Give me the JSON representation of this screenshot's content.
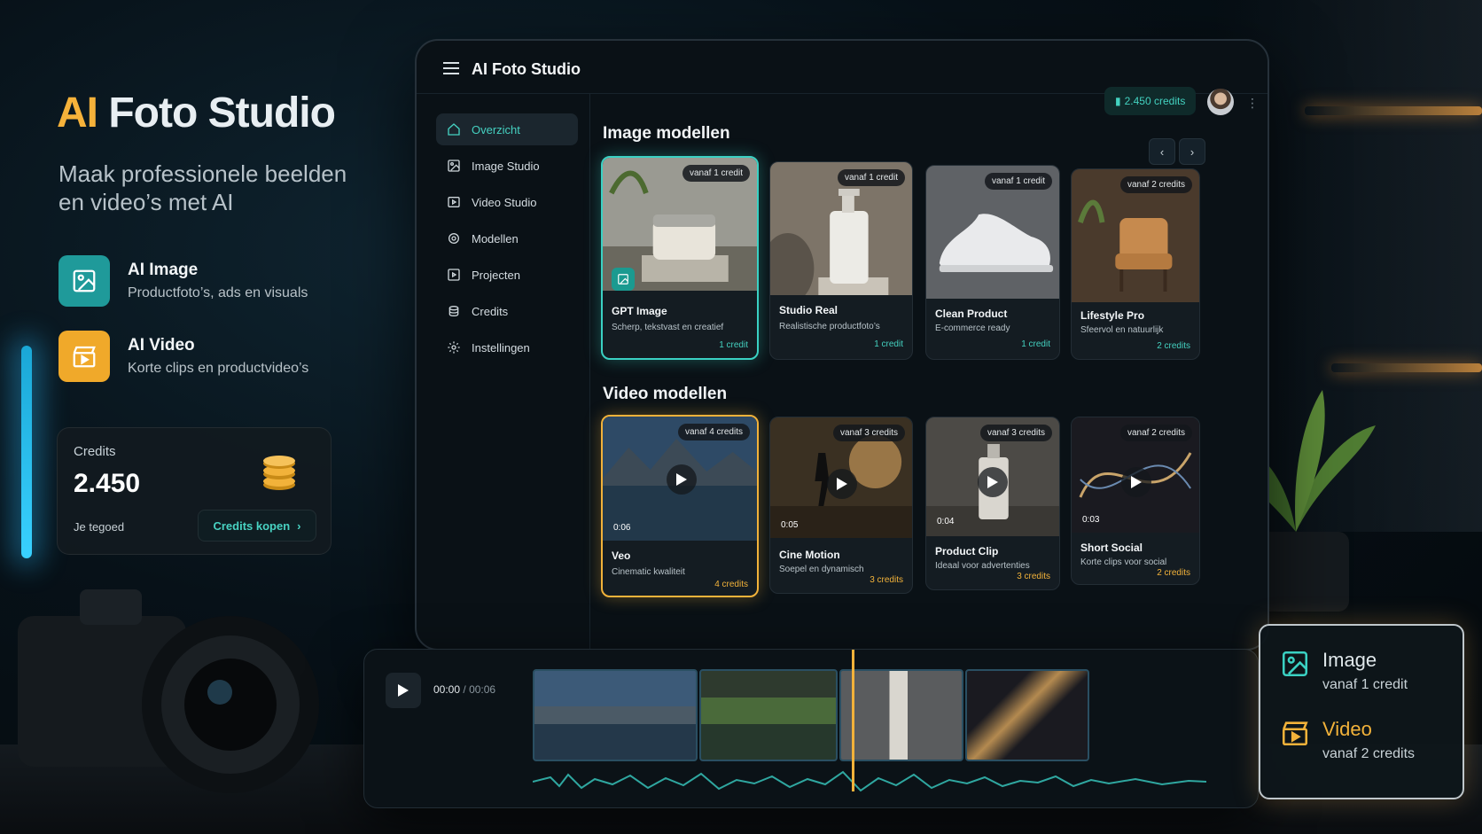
{
  "hero": {
    "title_accent": "AI",
    "title_rest": "Foto Studio",
    "subtitle_line1": "Maak professionele beelden",
    "subtitle_line2": "en video’s met AI",
    "features": [
      {
        "title": "AI Image",
        "desc": "Productfoto’s, ads en visuals",
        "icon": "image-icon",
        "color": "#1f9a9a"
      },
      {
        "title": "AI Video",
        "desc": "Korte clips en productvideo’s",
        "icon": "clapperboard-icon",
        "color": "#f0a92a"
      }
    ]
  },
  "credits_card": {
    "label": "Credits",
    "value": "2.450",
    "sub": "Je tegoed",
    "button": "Credits kopen"
  },
  "app": {
    "title": "AI Foto Studio",
    "credits": "2.450 credits",
    "nav": [
      {
        "label": "Overzicht",
        "icon": "home-icon",
        "active": true
      },
      {
        "label": "Image Studio",
        "icon": "image-icon"
      },
      {
        "label": "Video Studio",
        "icon": "video-icon"
      },
      {
        "label": "Modellen",
        "icon": "models-icon"
      },
      {
        "label": "Projecten",
        "icon": "projects-icon"
      },
      {
        "label": "Credits",
        "icon": "coins-icon"
      },
      {
        "label": "Instellingen",
        "icon": "gear-icon"
      }
    ],
    "image_section": "Image modellen",
    "video_section": "Video modellen",
    "image_models": [
      {
        "badge": "vanaf 1 credit",
        "title": "GPT Image",
        "desc": "Scherp, tekstvast en creatief",
        "price": "1 credit"
      },
      {
        "badge": "vanaf 1 credit",
        "title": "Studio Real",
        "desc": "Realistische productfoto’s",
        "price": "1 credit"
      },
      {
        "badge": "vanaf 1 credit",
        "title": "Clean Product",
        "desc": "E-commerce ready",
        "price": "1 credit"
      },
      {
        "badge": "vanaf 2 credits",
        "title": "Lifestyle Pro",
        "desc": "Sfeervol en natuurlijk",
        "price": "2 credits"
      }
    ],
    "video_models": [
      {
        "badge": "vanaf 4 credits",
        "duration": "0:06",
        "title": "Veo",
        "desc": "Cinematic kwaliteit",
        "price": "4 credits"
      },
      {
        "badge": "vanaf 3 credits",
        "duration": "0:05",
        "title": "Cine Motion",
        "desc": "Soepel en dynamisch",
        "price": "3 credits"
      },
      {
        "badge": "vanaf 3 credits",
        "duration": "0:04",
        "title": "Product Clip",
        "desc": "Ideaal voor advertenties",
        "price": "3 credits"
      },
      {
        "badge": "vanaf 2 credits",
        "duration": "0:03",
        "title": "Short Social",
        "desc": "Korte clips voor social",
        "price": "2 credits"
      }
    ]
  },
  "timeline": {
    "current": "00:00",
    "total": "00:06"
  },
  "pricing_card": {
    "image_title": "Image",
    "image_sub": "vanaf 1 credit",
    "video_title": "Video",
    "video_sub": "vanaf 2 credits"
  },
  "colors": {
    "accent_teal": "#3ad1c3",
    "accent_gold": "#f2b23a"
  }
}
